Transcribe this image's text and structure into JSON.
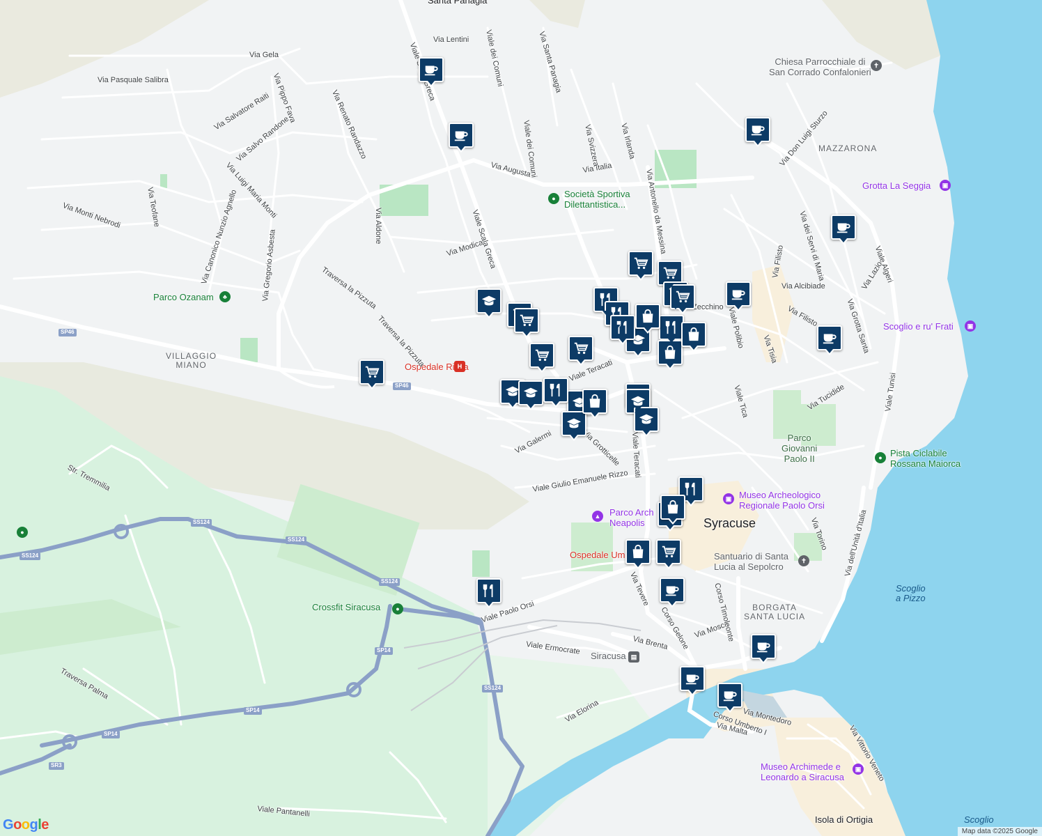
{
  "map": {
    "colors": {
      "land": "#f1f3f4",
      "park": "#cdeccf",
      "water": "#8ed4ee",
      "highway": "#8ba0c7",
      "road": "#ffffff",
      "pin": "#0d3b66",
      "town": "#f8efdc",
      "hill": "#e8eadf"
    },
    "places": {
      "santa_panagia": "Santa Panagia",
      "villaggio_miano": "VILLAGGIO\nMIANO",
      "mazzarona": "MAZZARONA",
      "syracuse": "Syracuse",
      "borgata": "BORGATA\nSANTA LUCIA",
      "isola_ortigia": "Isola di Ortigia"
    },
    "water_labels": {
      "scoglio_pizzo": "Scoglio\na Pizzo",
      "scoglio": "Scoglio"
    },
    "pois": {
      "chiesa": "Chiesa Parrocchiale di\nSan Corrado Confalonieri",
      "grotta": "Grotta La Seggia",
      "societa": "Società Sportiva\nDilettantistica...",
      "parco_ozanam": "Parco Ozanam",
      "ospedale_rizza": "Ospedale Rizza",
      "scoglio_frati": "Scoglio e ru' Frati",
      "parco_giovanni": "Parco\nGiovanni\nPaolo II",
      "pista": "Pista Ciclabile\nRossana Maiorca",
      "museo_arch": "Museo Archeologico\nRegionale Paolo Orsi",
      "parco_neapolis": "Parco Arch\nNeapolis",
      "ospedale_um": "Ospedale Um",
      "santuario": "Santuario di Santa\nLucia al Sepolcro",
      "crossfit": "Crossfit Siracusa",
      "stazione": "Siracusa",
      "museo_archimede": "Museo Archimede e\nLeonardo a Siracusa"
    },
    "streets": {
      "s1": "Via Lentini",
      "s2": "Via Gela",
      "s3": "Via Pasquale Salibra",
      "s4": "Via Salvatore Raiti",
      "s5": "Via Salvo Randone",
      "s6": "Via Pippo Fava",
      "s7": "Via Renato Randazzo",
      "s8": "Via Luigi Maria Monti",
      "s9": "Via Canonico Nunzio Agnello",
      "s10": "Via Teofane",
      "s11": "Via Monti Nebrodi",
      "s12": "Via Aldone",
      "s13": "Via Gregorio Asbesta",
      "s14": "Traversa la Pizzuta",
      "s15": "Traversa la Pizzuta",
      "s16": "Via Modica",
      "s17": "Viale Scala Greca",
      "s18": "Viale Scala Greca",
      "s19": "Viale dei Comuni",
      "s20": "Viale dei Comuni",
      "s21": "Via Santa Panagia",
      "s22": "Via Augusta",
      "s23": "Via Italia",
      "s24": "Via Svizzera",
      "s25": "Via Irlanda",
      "s26": "Via Antonello da Messina",
      "s27": "Via Don Luigi Sturzo",
      "s28": "Via dei Servi di Maria",
      "s29": "Viale Algeri",
      "s30": "Via Filisto",
      "s31": "Via Alcibiade",
      "s32": "Via Lazio",
      "s33": "Via Grotta Santa",
      "s34": "Via Filisto",
      "s35": "Via Tisia",
      "s36": "Viale Polibio",
      "s37": "Viale Tica",
      "s38": "Via Tucidide",
      "s39": "Viale Tunisi",
      "s40": "Viale Teracati",
      "s41": "Viale Teracati",
      "s42": "Via Galermi",
      "s43": "Viale Giulio Emanuele Rizzo",
      "s44": "Via Grotticelle",
      "s45": "Str. Tremmilia",
      "s46": "Viale Paolo Orsi",
      "s47": "Viale Ermocrate",
      "s48": "Via Brenta",
      "s49": "Via Mosco",
      "s50": "Corso Timoleonte",
      "s51": "Via Tevere",
      "s52": "Corso Gelone",
      "s53": "Via Elorina",
      "s54": "Via Montedoro",
      "s55": "Corso Umberto I",
      "s56": "Via Malta",
      "s57": "Via Vittorio Veneto",
      "s58": "Via dell'Unità d'Italia",
      "s59": "Via Torino",
      "s60": "Traversa Palma",
      "s61": "Viale Pantanelli",
      "s62": "Zecchino"
    },
    "shields": {
      "sp46a": "SP46",
      "sp46b": "SP46",
      "ss124a": "SS124",
      "ss124b": "SS124",
      "ss124c": "SS124",
      "ss124d": "SS124",
      "ss124e": "SS124",
      "sp14a": "SP14",
      "sp14b": "SP14",
      "sp14c": "SP14",
      "sr3": "SR3"
    },
    "markers": [
      {
        "type": "cafe"
      },
      {
        "type": "cafe"
      },
      {
        "type": "cafe"
      },
      {
        "type": "cafe"
      },
      {
        "type": "cafe"
      },
      {
        "type": "cafe"
      },
      {
        "type": "cafe"
      },
      {
        "type": "cafe"
      },
      {
        "type": "cafe"
      },
      {
        "type": "cafe"
      },
      {
        "type": "school"
      },
      {
        "type": "school"
      },
      {
        "type": "school"
      },
      {
        "type": "school"
      },
      {
        "type": "school"
      },
      {
        "type": "school"
      },
      {
        "type": "school"
      },
      {
        "type": "school"
      },
      {
        "type": "school"
      },
      {
        "type": "grocery"
      },
      {
        "type": "grocery"
      },
      {
        "type": "grocery"
      },
      {
        "type": "grocery"
      },
      {
        "type": "grocery"
      },
      {
        "type": "grocery"
      },
      {
        "type": "grocery"
      },
      {
        "type": "grocery"
      },
      {
        "type": "grocery"
      },
      {
        "type": "grocery"
      },
      {
        "type": "grocery"
      },
      {
        "type": "restaurant"
      },
      {
        "type": "restaurant"
      },
      {
        "type": "restaurant"
      },
      {
        "type": "restaurant"
      },
      {
        "type": "restaurant"
      },
      {
        "type": "restaurant"
      },
      {
        "type": "restaurant"
      },
      {
        "type": "shopping"
      },
      {
        "type": "shopping"
      },
      {
        "type": "shopping"
      },
      {
        "type": "shopping"
      },
      {
        "type": "shopping"
      },
      {
        "type": "shopping"
      }
    ],
    "logo": "Google",
    "attribution": "Map data ©2025 Google"
  }
}
